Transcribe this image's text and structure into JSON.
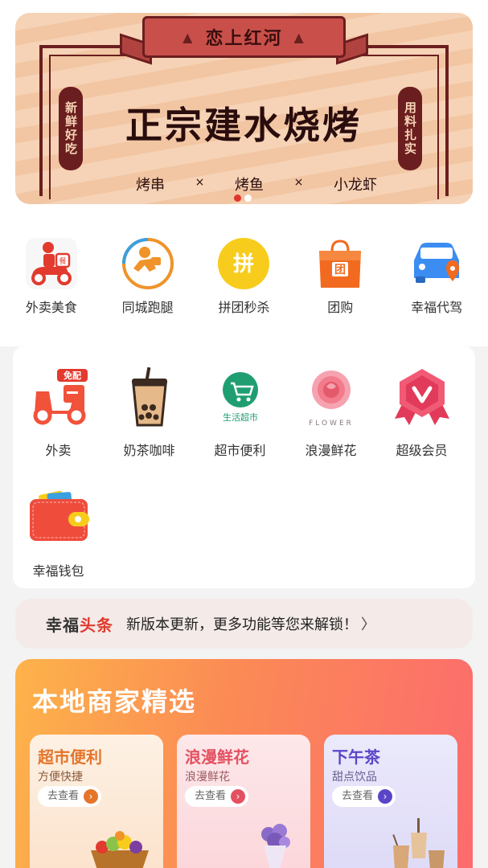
{
  "banner": {
    "ribbon_text": "恋上红河",
    "left_tag": "新鲜好吃",
    "right_tag": "用料扎实",
    "title": "正宗建水烧烤",
    "items": [
      "烤串",
      "烤鱼",
      "小龙虾"
    ],
    "separator": "×",
    "dots": 2,
    "active_dot": 0
  },
  "topnav": [
    {
      "label": "外卖美食",
      "icon": "scooter-delivery-icon"
    },
    {
      "label": "同城跑腿",
      "icon": "runner-icon"
    },
    {
      "label": "拼团秒杀",
      "icon": "group-buy-icon",
      "glyph": "拼"
    },
    {
      "label": "团购",
      "icon": "shopping-bag-icon",
      "glyph": "团"
    },
    {
      "label": "幸福代驾",
      "icon": "car-icon"
    }
  ],
  "services": {
    "row1": [
      {
        "label": "外卖",
        "icon": "scooter-icon",
        "badge": "免配"
      },
      {
        "label": "奶茶咖啡",
        "icon": "bubble-tea-icon"
      },
      {
        "label": "超市便利",
        "icon": "supermarket-cart-icon",
        "sub": "生活超市"
      },
      {
        "label": "浪漫鲜花",
        "icon": "rose-icon",
        "sub": "FLOWER"
      },
      {
        "label": "超级会员",
        "icon": "vip-badge-icon",
        "glyph": "V"
      }
    ],
    "row2": [
      {
        "label": "幸福钱包",
        "icon": "wallet-icon"
      }
    ]
  },
  "headline": {
    "brand_a": "幸福",
    "brand_b": "头条",
    "text": "新版本更新，更多功能等您来解锁！",
    "arrow": "〉"
  },
  "local": {
    "title": "本地商家精选",
    "cards": [
      {
        "title": "超市便利",
        "subtitle": "方便快捷",
        "go": "去查看",
        "color": "#e4752a",
        "bg": "#fdf1e4"
      },
      {
        "title": "浪漫鲜花",
        "subtitle": "浪漫鲜花",
        "go": "去查看",
        "color": "#e45060",
        "bg": "#fde8ea"
      },
      {
        "title": "下午茶",
        "subtitle": "甜点饮品",
        "go": "去查看",
        "color": "#5a45c9",
        "bg": "#ebe9fb"
      }
    ]
  }
}
